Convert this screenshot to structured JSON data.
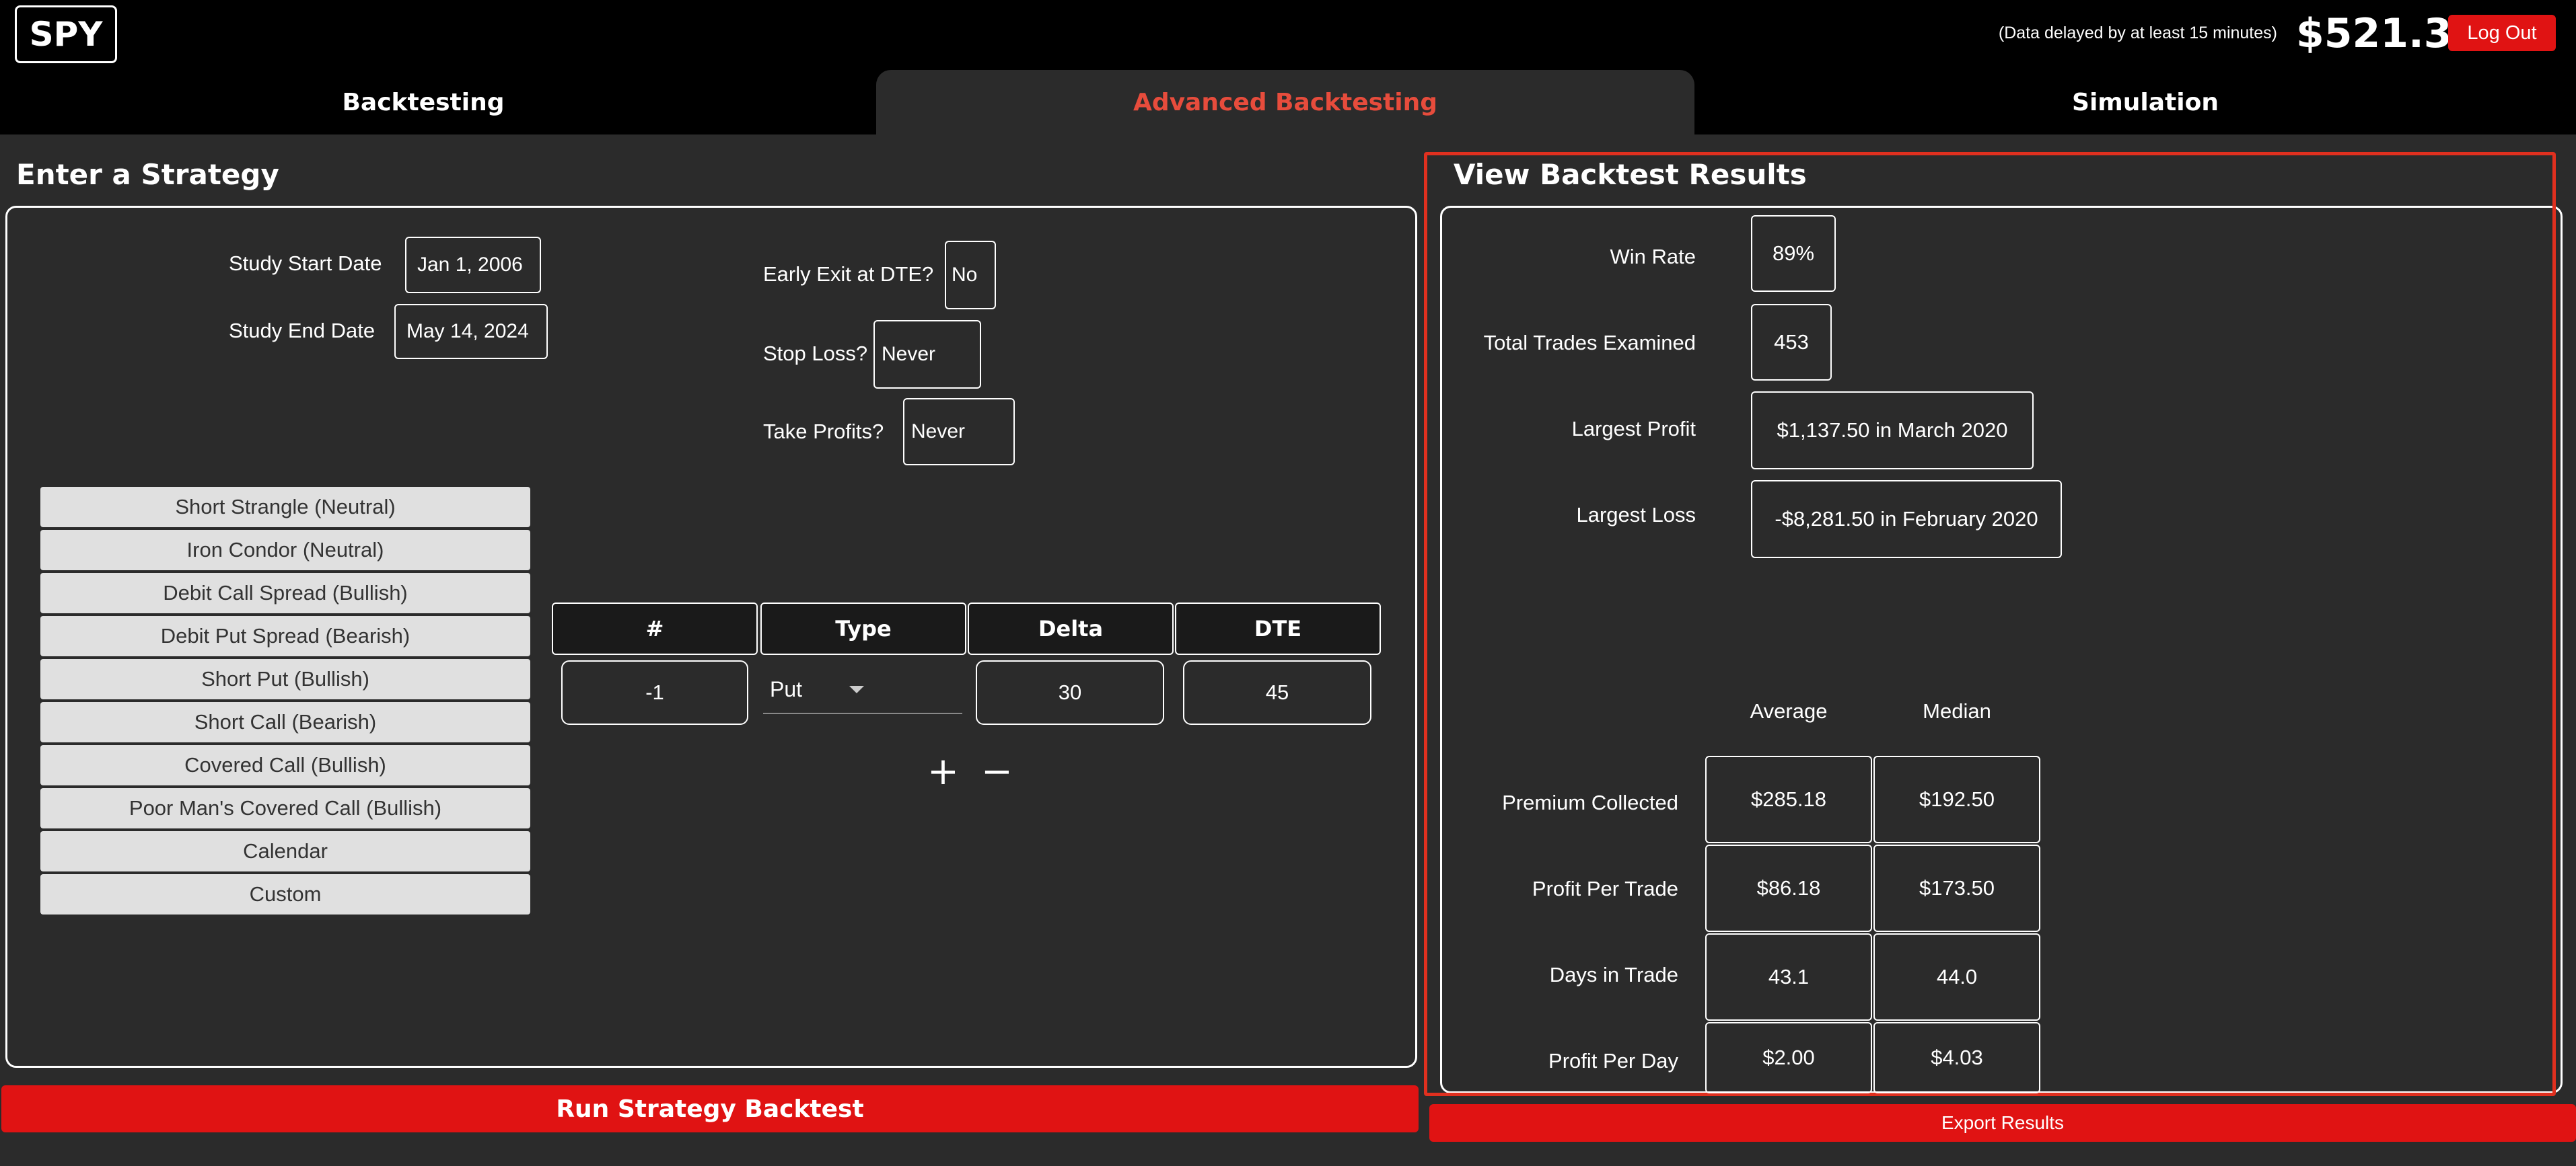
{
  "header": {
    "logo": "SPY",
    "delay_note": "(Data delayed by at least 15 minutes)",
    "price": "$521.30",
    "logout_label": "Log Out"
  },
  "tabs": [
    {
      "label": "Backtesting",
      "active": false
    },
    {
      "label": "Advanced Backtesting",
      "active": true
    },
    {
      "label": "Simulation",
      "active": false
    }
  ],
  "strategy": {
    "title": "Enter a Strategy",
    "start_date_label": "Study Start Date",
    "start_date_value": "Jan 1, 2006",
    "end_date_label": "Study End Date",
    "end_date_value": "May 14, 2024",
    "early_exit_label": "Early Exit at DTE?",
    "early_exit_value": "No",
    "stop_loss_label": "Stop Loss?",
    "stop_loss_value": "Never",
    "take_profits_label": "Take Profits?",
    "take_profits_value": "Never",
    "presets": [
      "Short Strangle (Neutral)",
      "Iron Condor (Neutral)",
      "Debit Call Spread (Bullish)",
      "Debit Put Spread (Bearish)",
      "Short Put (Bullish)",
      "Short Call (Bearish)",
      "Covered Call (Bullish)",
      "Poor Man's Covered Call (Bullish)",
      "Calendar",
      "Custom"
    ],
    "legs_table": {
      "headers": [
        "#",
        "Type",
        "Delta",
        "DTE"
      ],
      "rows": [
        {
          "count": "-1",
          "type": "Put",
          "delta": "30",
          "dte": "45"
        }
      ]
    },
    "add_row_symbol": "+",
    "remove_row_symbol": "−",
    "run_button_label": "Run Strategy Backtest"
  },
  "results": {
    "title": "View Backtest Results",
    "win_rate_label": "Win Rate",
    "win_rate_value": "89%",
    "total_trades_label": "Total Trades Examined",
    "total_trades_value": "453",
    "largest_profit_label": "Largest Profit",
    "largest_profit_value": "$1,137.50 in March 2020",
    "largest_loss_label": "Largest Loss",
    "largest_loss_value": "-$8,281.50 in February 2020",
    "stats_columns": [
      "Average",
      "Median"
    ],
    "stats_rows": [
      {
        "label": "Premium Collected",
        "average": "$285.18",
        "median": "$192.50"
      },
      {
        "label": "Profit Per Trade",
        "average": "$86.18",
        "median": "$173.50"
      },
      {
        "label": "Days in Trade",
        "average": "43.1",
        "median": "44.0"
      },
      {
        "label": "Profit Per Day",
        "average": "$2.00",
        "median": "$4.03"
      }
    ],
    "export_button_label": "Export Results"
  },
  "colors": {
    "accent_red": "#e01313",
    "active_tab_text": "#e74c3c",
    "background": "#2b2b2b",
    "header_background": "#000000"
  }
}
